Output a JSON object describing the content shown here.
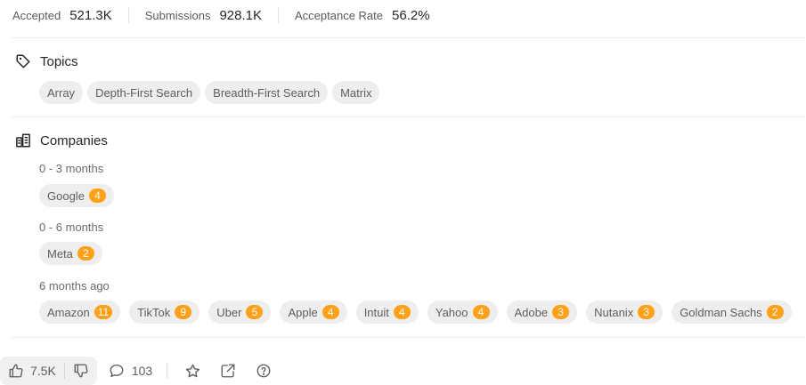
{
  "stats": [
    {
      "label": "Accepted",
      "value": "521.3K"
    },
    {
      "label": "Submissions",
      "value": "928.1K"
    },
    {
      "label": "Acceptance Rate",
      "value": "56.2%"
    }
  ],
  "topics": {
    "title": "Topics",
    "tags": [
      "Array",
      "Depth-First Search",
      "Breadth-First Search",
      "Matrix"
    ]
  },
  "companies": {
    "title": "Companies",
    "groups": [
      {
        "period": "0 - 3 months",
        "items": [
          {
            "name": "Google",
            "count": "4"
          }
        ]
      },
      {
        "period": "0 - 6 months",
        "items": [
          {
            "name": "Meta",
            "count": "2"
          }
        ]
      },
      {
        "period": "6 months ago",
        "items": [
          {
            "name": "Amazon",
            "count": "11"
          },
          {
            "name": "TikTok",
            "count": "9"
          },
          {
            "name": "Uber",
            "count": "5"
          },
          {
            "name": "Apple",
            "count": "4"
          },
          {
            "name": "Intuit",
            "count": "4"
          },
          {
            "name": "Yahoo",
            "count": "4"
          },
          {
            "name": "Adobe",
            "count": "3"
          },
          {
            "name": "Nutanix",
            "count": "3"
          },
          {
            "name": "Goldman Sachs",
            "count": "2"
          }
        ]
      }
    ]
  },
  "footer": {
    "likes": "7.5K",
    "comments": "103",
    "icons": [
      "thumbs-up-icon",
      "thumbs-down-icon",
      "comment-icon",
      "star-icon",
      "share-icon",
      "help-icon"
    ]
  },
  "colors": {
    "badge": "#ffa116",
    "tag_bg": "#eeeeee",
    "divider": "#ebebeb"
  }
}
